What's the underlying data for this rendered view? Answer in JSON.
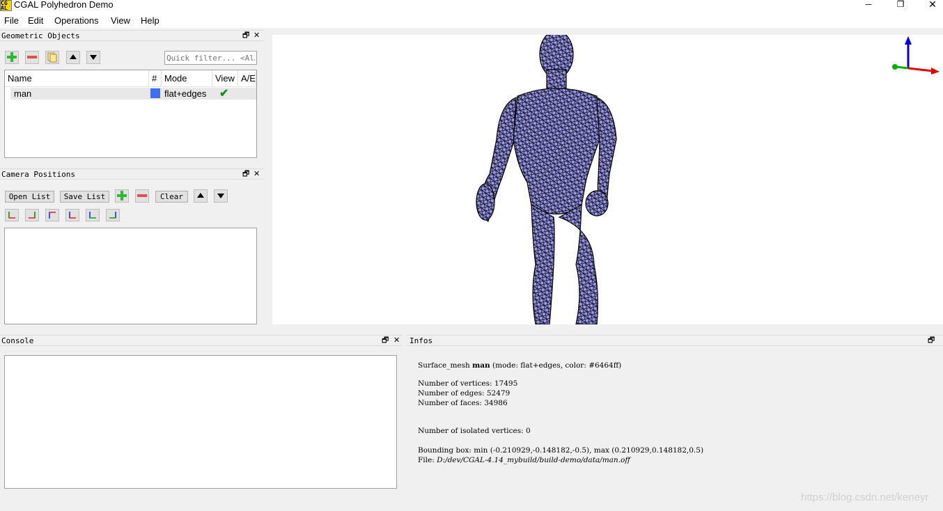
{
  "window": {
    "title": "CGAL Polyhedron Demo",
    "minimize": "─",
    "restore": "❐",
    "close": "✕"
  },
  "menu": [
    "File",
    "Edit",
    "Operations",
    "View",
    "Help"
  ],
  "geometric_objects": {
    "title": "Geometric Objects",
    "filter_placeholder": "Quick filter... <Al…",
    "columns": [
      "Name",
      "#",
      "Mode",
      "View",
      "A/E"
    ],
    "rows": [
      {
        "name": "man",
        "color": "#6464ff",
        "mode": "flat+edges",
        "view": "✔"
      }
    ]
  },
  "camera_positions": {
    "title": "Camera Positions",
    "open_list": "Open List",
    "save_list": "Save List",
    "clear": "Clear"
  },
  "console": {
    "title": "Console"
  },
  "infos": {
    "title": "Infos",
    "summary_prefix": "Surface_mesh ",
    "summary_name": "man",
    "summary_suffix": " (mode: flat+edges, color: #6464ff)",
    "vertices": "Number of vertices: 17495",
    "edges": "Number of edges: 52479",
    "faces": "Number of faces: 34986",
    "isolated": "Number of isolated vertices: 0",
    "bbox": "Bounding box: min (-0.210929,-0.148182,-0.5), max (0.210929,0.148182,0.5)",
    "file_label": "File: ",
    "file_path": "D:/dev/CGAL-4.14_mybuild/build-demo/data/man.off"
  },
  "watermark": "https://blog.csdn.net/keneyr",
  "colors": {
    "mesh_fill": "#6464ff",
    "axis_x": "#e00000",
    "axis_y": "#00b000",
    "axis_z": "#0000e0"
  }
}
